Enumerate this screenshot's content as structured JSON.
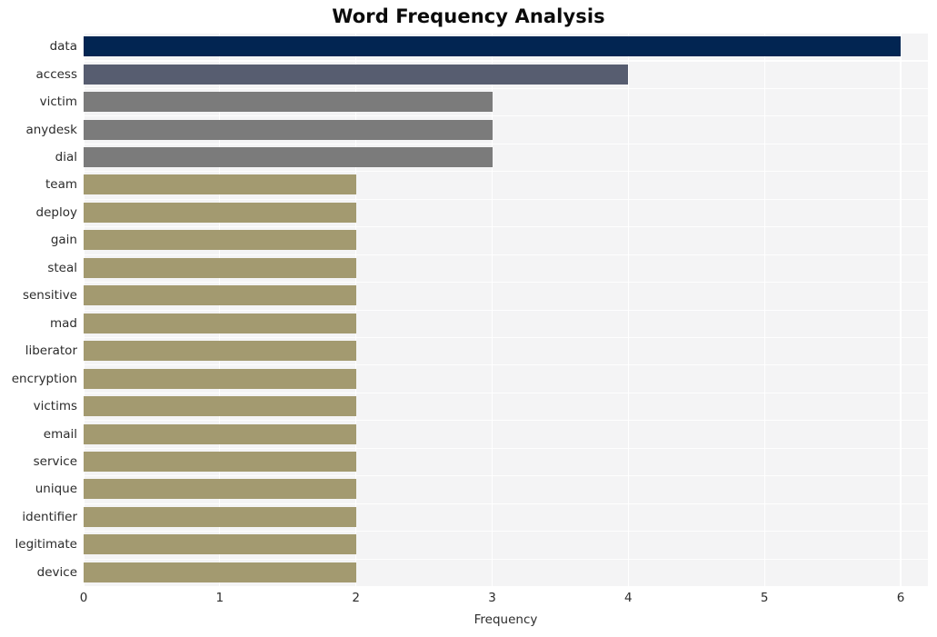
{
  "chart_data": {
    "type": "bar",
    "orientation": "horizontal",
    "title": "Word Frequency Analysis",
    "xlabel": "Frequency",
    "ylabel": "",
    "xlim": [
      0,
      6.2
    ],
    "xticks": [
      0,
      1,
      2,
      3,
      4,
      5,
      6
    ],
    "xtick_labels": [
      "0",
      "1",
      "2",
      "3",
      "4",
      "5",
      "6"
    ],
    "grid": true,
    "legend": null,
    "background": "#f4f4f5",
    "gridline_color": "#ffffff",
    "categories": [
      "data",
      "access",
      "victim",
      "anydesk",
      "dial",
      "team",
      "deploy",
      "gain",
      "steal",
      "sensitive",
      "mad",
      "liberator",
      "encryption",
      "victims",
      "email",
      "service",
      "unique",
      "identifier",
      "legitimate",
      "device"
    ],
    "values": [
      6,
      4,
      3,
      3,
      3,
      2,
      2,
      2,
      2,
      2,
      2,
      2,
      2,
      2,
      2,
      2,
      2,
      2,
      2,
      2
    ],
    "bar_colors": [
      "#022552",
      "#575d70",
      "#7b7b7b",
      "#7b7b7b",
      "#7b7b7b",
      "#a39a70",
      "#a39a70",
      "#a39a70",
      "#a39a70",
      "#a39a70",
      "#a39a70",
      "#a39a70",
      "#a39a70",
      "#a39a70",
      "#a39a70",
      "#a39a70",
      "#a39a70",
      "#a39a70",
      "#a39a70",
      "#a39a70"
    ]
  }
}
